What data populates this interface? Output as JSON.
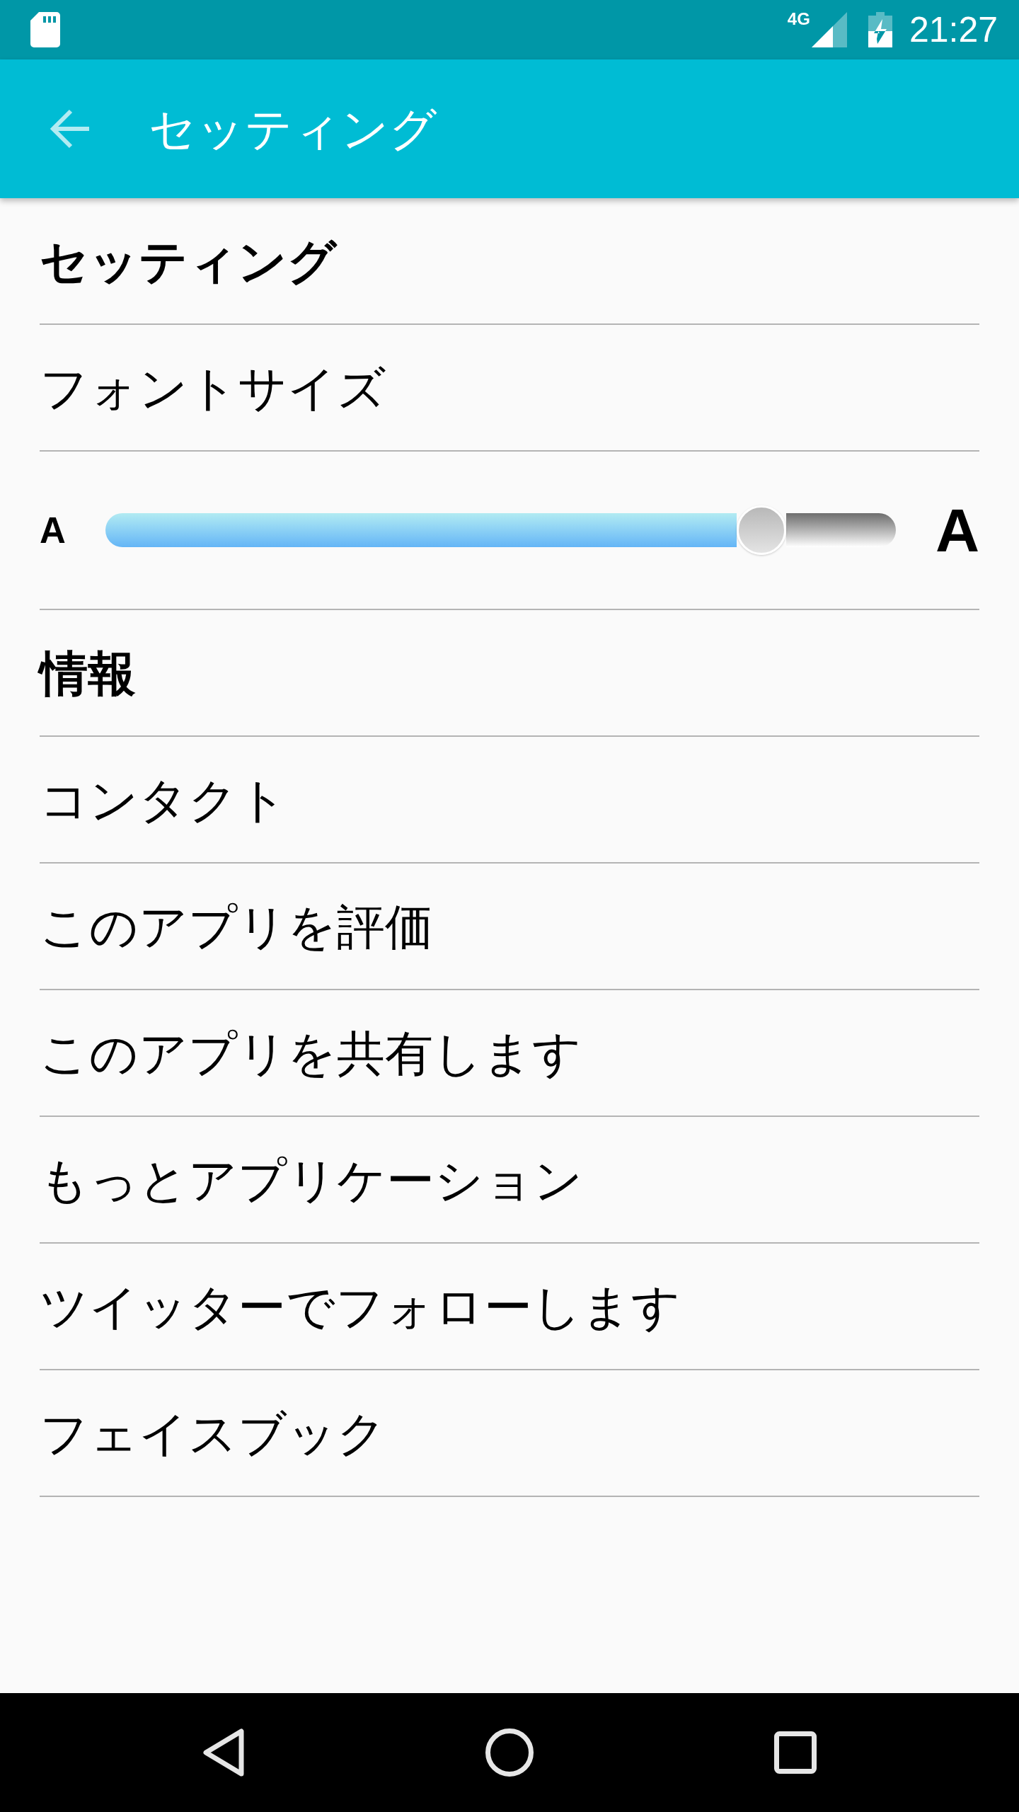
{
  "status_bar": {
    "network_type": "4G",
    "time": "21:27"
  },
  "app_bar": {
    "title": "セッティング"
  },
  "sections": [
    {
      "title": "セッティング",
      "items": [
        {
          "kind": "link",
          "label": "フォントサイズ"
        },
        {
          "kind": "slider",
          "min_label": "A",
          "max_label": "A",
          "level": 0.83
        }
      ]
    },
    {
      "title": "情報",
      "items": [
        {
          "kind": "link",
          "label": "コンタクト"
        },
        {
          "kind": "link",
          "label": "このアプリを評価"
        },
        {
          "kind": "link",
          "label": "このアプリを共有します"
        },
        {
          "kind": "link",
          "label": "もっとアプリケーション"
        },
        {
          "kind": "link",
          "label": "ツイッターでフォローします"
        },
        {
          "kind": "link",
          "label": "フェイスブック"
        }
      ]
    }
  ]
}
